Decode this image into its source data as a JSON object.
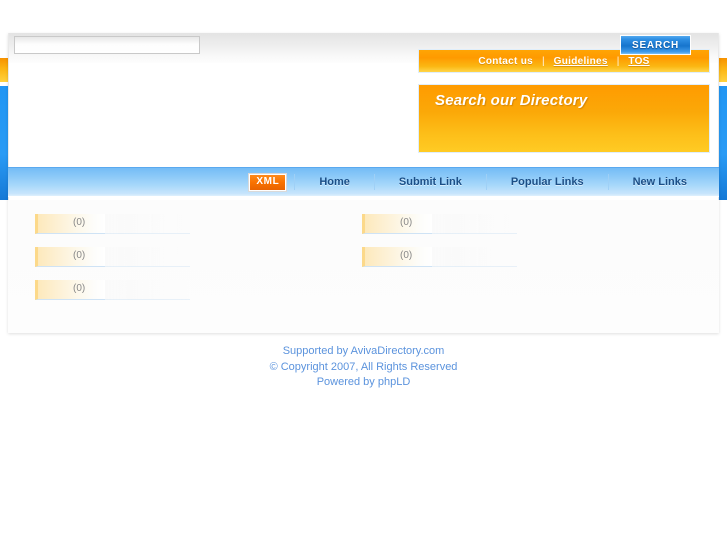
{
  "top_links": {
    "items": [
      {
        "label": "Contact us",
        "underlined": false
      },
      {
        "label": "Guidelines",
        "underlined": true
      },
      {
        "label": "TOS",
        "underlined": true
      }
    ],
    "separator": "|"
  },
  "search": {
    "title": "Search our Directory",
    "input_value": "",
    "placeholder": "",
    "button_label": "SEARCH"
  },
  "nav": {
    "xml_badge": "XML",
    "items": [
      {
        "label": "Home"
      },
      {
        "label": "Submit Link"
      },
      {
        "label": "Popular Links"
      },
      {
        "label": "New Links"
      }
    ]
  },
  "categories": {
    "left_column": [
      {
        "name": "",
        "count": "(0)"
      },
      {
        "name": "",
        "count": "(0)"
      },
      {
        "name": "",
        "count": "(0)"
      }
    ],
    "right_column": [
      {
        "name": "",
        "count": "(0)"
      },
      {
        "name": "",
        "count": "(0)"
      }
    ]
  },
  "footer": {
    "line1_prefix": "Supported by ",
    "line1_link": "AvivaDirectory.com",
    "line2": "© Copyright 2007, All Rights Reserved",
    "line3_prefix": "Powered by ",
    "line3_link": "phpLD"
  },
  "colors": {
    "orange": "#ff9a00",
    "orange_light": "#ffcb24",
    "blue": "#2196f3",
    "nav_blue": "#8cc9f8",
    "nav_text": "#1b4f87",
    "footer_text": "#5b93dd",
    "xml_badge": "#f97200"
  }
}
